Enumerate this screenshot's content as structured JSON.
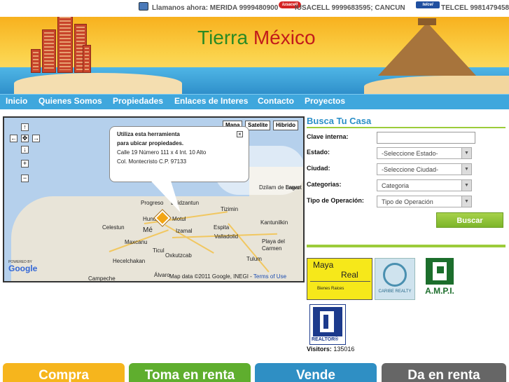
{
  "topbar": {
    "call_prefix": "Llamanos ahora: MERIDA 9999480900",
    "iusacell": "IUSACELL 9999683595; CANCUN",
    "telcel": "TELCEL 9981479458",
    "iusacell_logo_text": "iusacell",
    "telcel_logo_text": "telcel"
  },
  "header": {
    "title_part1": "Tierra",
    "title_part2": "México",
    "colors": {
      "green": "#2a8a24",
      "red": "#c21b1b"
    }
  },
  "nav": {
    "items": [
      "Inicio",
      "Quienes Somos",
      "Propiedades",
      "Enlaces de Interes",
      "Contacto",
      "Proyectos"
    ]
  },
  "map": {
    "map_types": [
      "Mapa",
      "Satelite",
      "Hibrido"
    ],
    "popup": {
      "line1": "Utiliza esta herramienta",
      "line2": "para ubicar propiedades.",
      "line3": "Calle 19 Número 111 x 4 Int. 10 Alto",
      "line4": "Col. Montecristo C.P. 97133"
    },
    "places": {
      "dzilam": "Dzilam de Bravo",
      "lagart": "Lagart",
      "progreso": "Progreso",
      "dzidzantun": "Dzidzantun",
      "tizimin": "Tizimin",
      "celestun": "Celestun",
      "hunucma": "Hunu",
      "motul": "Motul",
      "merida": "Mé",
      "izamal": "Izamal",
      "espita": "Espita",
      "kantunilkin": "Kantunilkin",
      "valladolid": "Valladolid",
      "maxcanu": "Maxcanu",
      "playa": "Playa del",
      "carmen": "Carmen",
      "ticul": "Ticul",
      "oxkutzcab": "Oxkutzcab",
      "hecelchakan": "Hecelchakan",
      "tulum": "Tulum",
      "campeche": "Campeche",
      "alvaro": "Álvaro"
    },
    "powered_by": "POWERED BY",
    "google": "Google",
    "copyright": "Map data ©2011 Google, INEGI - ",
    "terms": "Terms of Use"
  },
  "search": {
    "title": "Busca Tu Casa",
    "clave_label": "Clave interna:",
    "clave_value": "",
    "estado_label": "Estado:",
    "estado_value": "-Seleccione Estado-",
    "ciudad_label": "Ciudad:",
    "ciudad_value": "-Seleccione Ciudad-",
    "categorias_label": "Categorias:",
    "categorias_value": "Categoria",
    "operacion_label": "Tipo de Operación:",
    "operacion_value": "Tipo de Operación",
    "button": "Buscar"
  },
  "partners": {
    "maya_1": "Maya",
    "maya_2": "Real",
    "maya_3": "Bienes Raices",
    "caribe": "CARIBE REALTY",
    "ampi": "A.M.P.I.",
    "realtor": "REALTOR®"
  },
  "visitors": {
    "label": "Visitors:",
    "count": "135016"
  },
  "actions": [
    {
      "label": "Compra",
      "color": "#f6b51d"
    },
    {
      "label": "Toma en renta",
      "color": "#5fae2e"
    },
    {
      "label": "Vende",
      "color": "#2f8fc4"
    },
    {
      "label": "Da en renta",
      "color": "#666666"
    }
  ]
}
